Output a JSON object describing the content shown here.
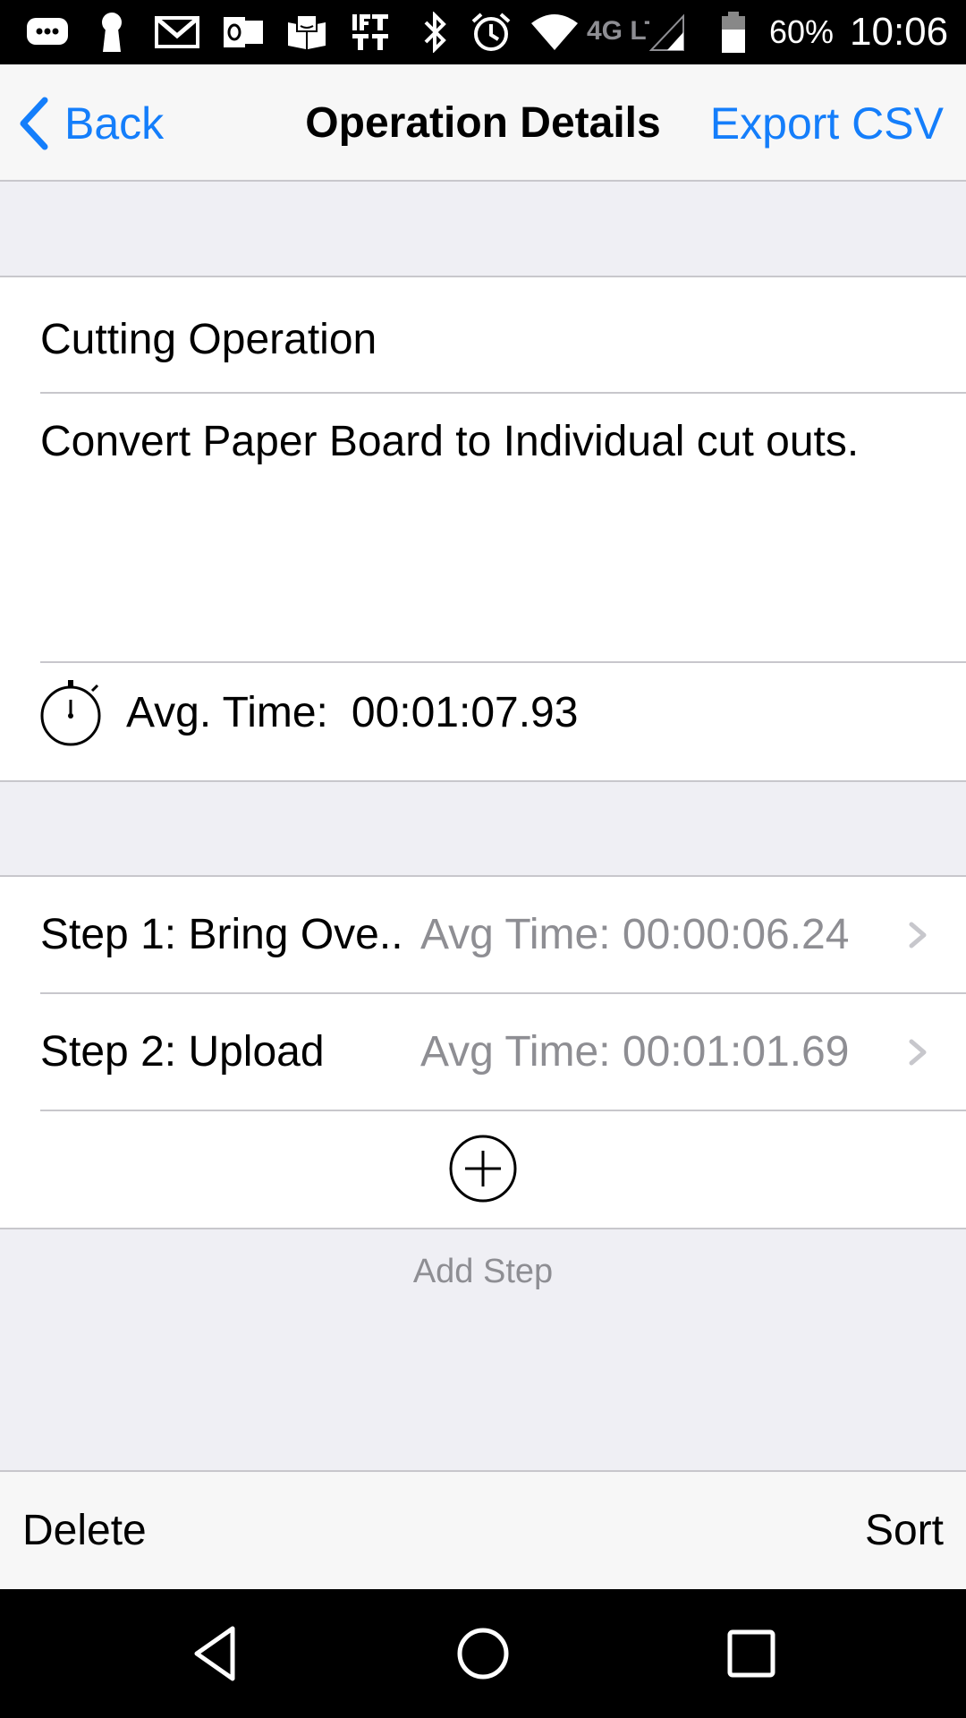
{
  "status_bar": {
    "icons": [
      "chat-icon",
      "keyhole-icon",
      "gmail-icon",
      "outlook-icon",
      "amazon-kindle-icon",
      "ifttt-icon",
      "bluetooth-icon",
      "alarm-icon",
      "wifi-icon",
      "4g-lte-icon",
      "cell-signal-icon",
      "battery-icon"
    ],
    "network_label": "4G LTE",
    "battery": "60%",
    "time": "10:06"
  },
  "nav": {
    "back_label": "Back",
    "title": "Operation Details",
    "export_label": "Export CSV"
  },
  "operation": {
    "name": "Cutting Operation",
    "description": "Convert Paper Board to Individual cut outs.",
    "avg_time_label": "Avg. Time:",
    "avg_time_value": "00:01:07.93"
  },
  "steps": [
    {
      "label": "Step 1: Bring Ove..",
      "avg_time": "Avg Time: 00:00:06.24"
    },
    {
      "label": "Step 2: Upload",
      "avg_time": "Avg Time: 00:01:01.69"
    }
  ],
  "add_step_label": "Add Step",
  "toolbar": {
    "delete_label": "Delete",
    "sort_label": "Sort"
  },
  "colors": {
    "accent": "#147efb",
    "secondary_text": "#8e8e93",
    "group_background": "#efeff4"
  }
}
